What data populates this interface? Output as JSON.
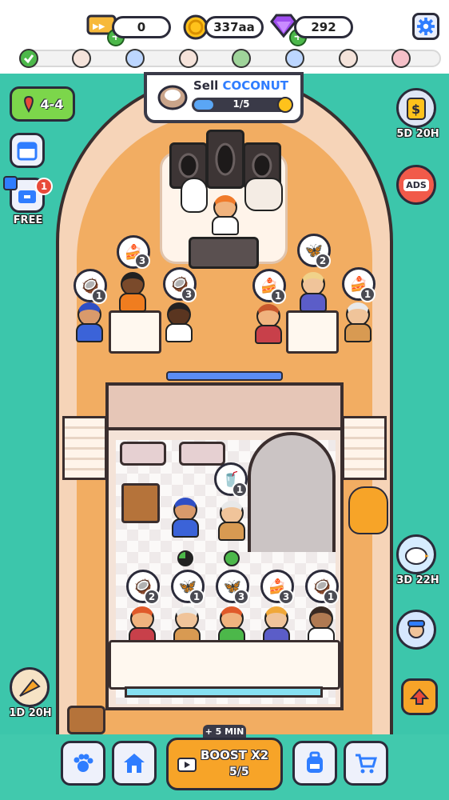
{
  "resources": {
    "tickets": "0",
    "coins": "337aa",
    "gems": "292"
  },
  "progress_tokens": [
    "check",
    "coconut",
    "butterfly",
    "coconut",
    "person",
    "butterfly",
    "coconut",
    "cake"
  ],
  "level": "4-4",
  "quest": {
    "sell_prefix": "Sell",
    "item": "COCONUT",
    "progress": "1/5",
    "progress_fraction": 0.2
  },
  "side_left": {
    "free_label": "FREE",
    "free_badge": "1",
    "event_timer": "1D 20H"
  },
  "side_right": {
    "pass_timer": "5D 20H",
    "ads_label": "ADS",
    "bird_timer": "3D 22H"
  },
  "deck_orders": [
    {
      "item": "coconut",
      "count": "1"
    },
    {
      "item": "cake",
      "count": "3"
    },
    {
      "item": "coconut",
      "count": "3"
    },
    {
      "item": "butterfly",
      "count": "2"
    },
    {
      "item": "cake",
      "count": "1"
    },
    {
      "item": "cake",
      "count": "1"
    }
  ],
  "cabin_orders": [
    {
      "item": "drink",
      "count": "1"
    }
  ],
  "counter_orders": [
    {
      "item": "coconut",
      "count": "2"
    },
    {
      "item": "butterfly",
      "count": "1"
    },
    {
      "item": "butterfly",
      "count": "3"
    },
    {
      "item": "cake",
      "count": "3"
    },
    {
      "item": "coconut",
      "count": "1"
    }
  ],
  "boost": {
    "tag": "+ 5 MIN",
    "label": "BOOST X2",
    "count": "5/5"
  },
  "colors": {
    "sea": "#3cc6ab",
    "deck": "#f2ad62",
    "boost": "#f7a428",
    "accent_blue": "#2f7dff"
  }
}
